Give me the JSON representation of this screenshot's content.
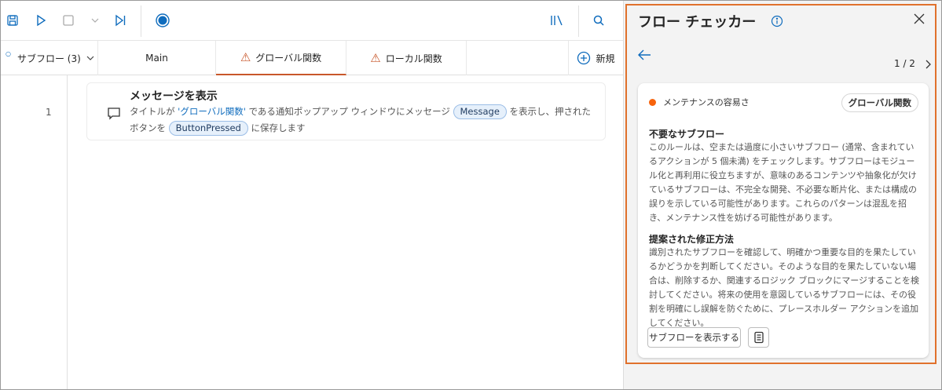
{
  "toolbar": {
    "icons": [
      "save-icon",
      "run-icon",
      "stop-icon",
      "chevron-down-icon",
      "run-next-icon",
      "record-icon",
      "variables-icon",
      "search-icon"
    ]
  },
  "tabs": {
    "subflows": "サブフロー (3)",
    "main": "Main",
    "global": "グローバル関数",
    "local": "ローカル関数",
    "new": "新規"
  },
  "action": {
    "line": "1",
    "title": "メッセージを表示",
    "desc_1": "タイトルが ",
    "desc_link": "'グローバル関数'",
    "desc_2": " である通知ポップアップ ウィンドウにメッセージ ",
    "var_message": "Message",
    "desc_3": " を表示し、押されたボタンを ",
    "var_button": "ButtonPressed",
    "desc_4": " に保存します"
  },
  "panel": {
    "title": "フロー チェッカー",
    "page": "1 / 2",
    "card": {
      "category": "メンテナンスの容易さ",
      "badge": "グローバル関数",
      "heading1": "不要なサブフロー",
      "body1": "このルールは、空または過度に小さいサブフロー (通常、含まれているアクションが 5 個未満) をチェックします。サブフローはモジュール化と再利用に役立ちますが、意味のあるコンテンツや抽象化が欠けているサブフローは、不完全な開発、不必要な断片化、または構成の誤りを示している可能性があります。これらのパターンは混乱を招き、メンテナンス性を妨げる可能性があります。",
      "heading2": "提案された修正方法",
      "body2": "識別されたサブフローを確認して、明確かつ重要な目的を果たしているかどうかを判断してください。そのような目的を果たしていない場合は、削除するか、関連するロジック ブロックにマージすることを検討してください。将来の使用を意図しているサブフローには、その役割を明確にし誤解を防ぐために、プレースホルダー アクションを追加してください。",
      "show_button": "サブフローを表示する"
    }
  },
  "colors": {
    "accent": "#0f6cbd",
    "highlight": "#e0712c",
    "warning": "#c8572a",
    "dot": "#f7630c"
  }
}
